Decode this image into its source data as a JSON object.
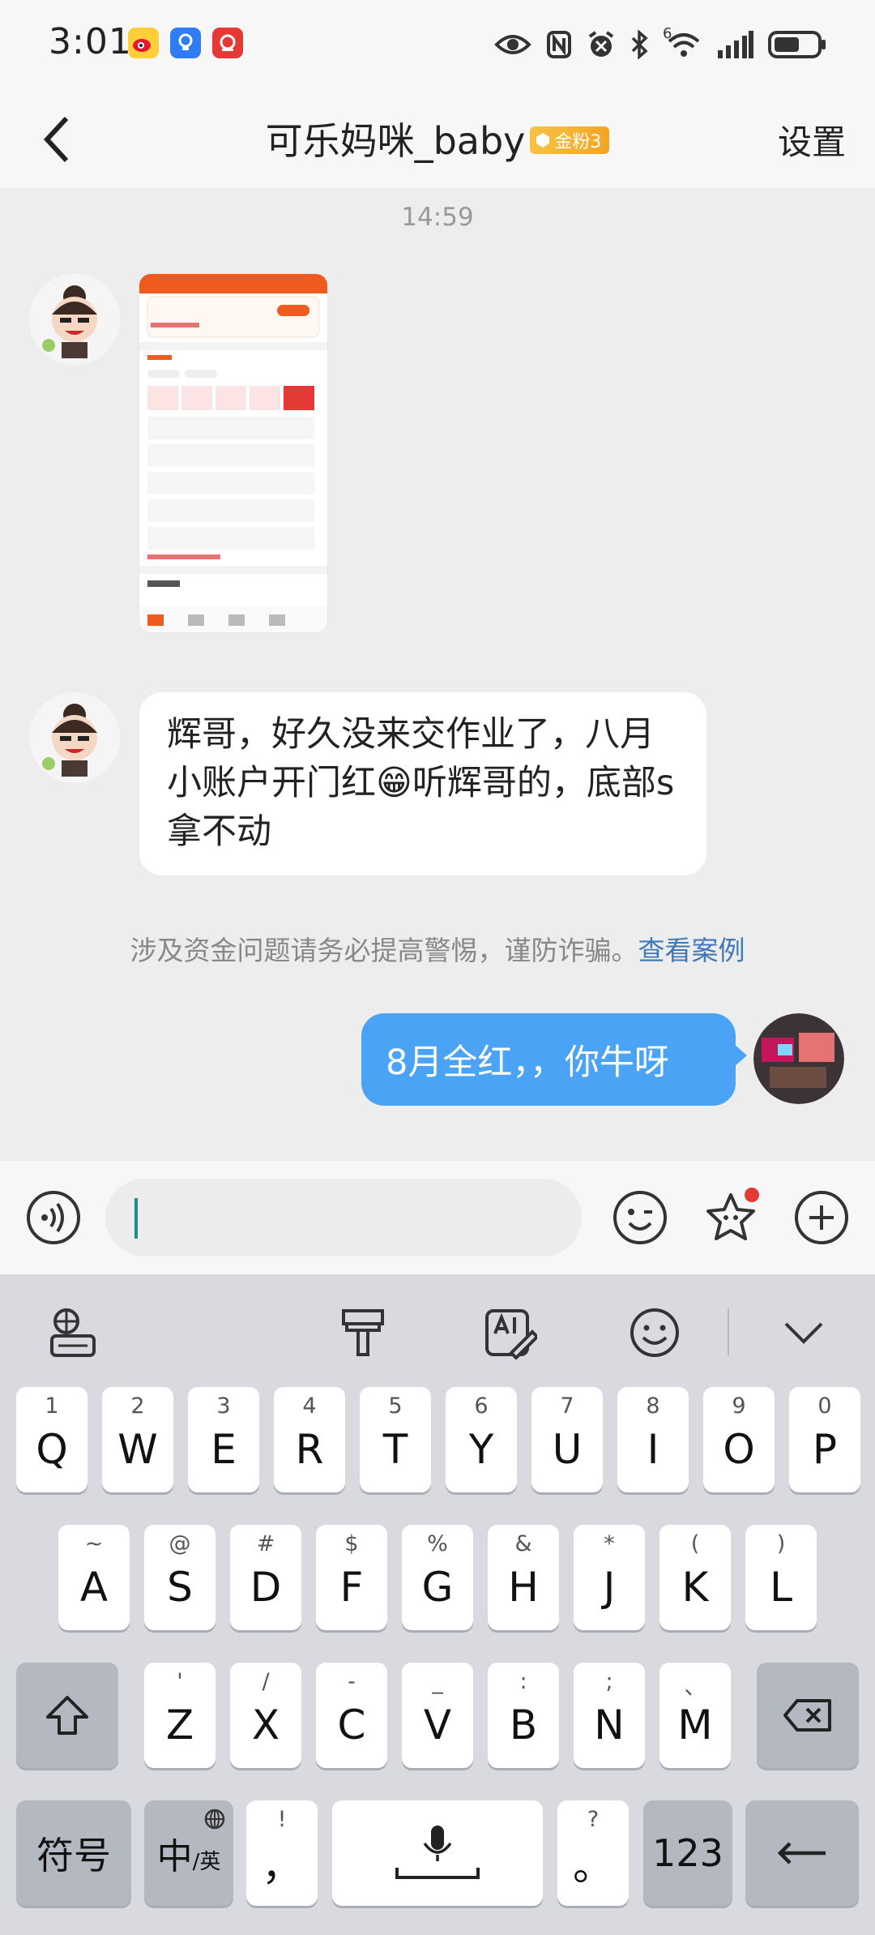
{
  "status_bar": {
    "time": "3:01",
    "apps": [
      "weibo-icon",
      "bulb-app-icon",
      "camera-app-icon"
    ],
    "indicators": [
      "eye-icon",
      "nfc-icon",
      "alarm-icon",
      "bluetooth-icon",
      "wifi-icon",
      "signal-icon",
      "battery-icon"
    ],
    "wifi_label": "6"
  },
  "header": {
    "title": "可乐妈咪_baby",
    "fan_badge": "金粉3",
    "settings_label": "设置"
  },
  "chat": {
    "timestamp": "14:59",
    "messages": [
      {
        "type": "image",
        "side": "left"
      },
      {
        "type": "text",
        "side": "left",
        "text": "辉哥，好久没来交作业了，八月小账户开门红😁听辉哥的，底部s拿不动"
      },
      {
        "type": "notice",
        "text": "涉及资金问题请务必提高警惕，谨防诈骗。",
        "link": "查看案例"
      },
      {
        "type": "text",
        "side": "right",
        "text": "8月全红，，你牛呀"
      }
    ]
  },
  "input_bar": {
    "value": "",
    "placeholder": ""
  },
  "keyboard": {
    "rows": [
      [
        {
          "main": "Q",
          "sub": "1"
        },
        {
          "main": "W",
          "sub": "2"
        },
        {
          "main": "E",
          "sub": "3"
        },
        {
          "main": "R",
          "sub": "4"
        },
        {
          "main": "T",
          "sub": "5"
        },
        {
          "main": "Y",
          "sub": "6"
        },
        {
          "main": "U",
          "sub": "7"
        },
        {
          "main": "I",
          "sub": "8"
        },
        {
          "main": "O",
          "sub": "9"
        },
        {
          "main": "P",
          "sub": "0"
        }
      ],
      [
        {
          "main": "A",
          "sub": "~"
        },
        {
          "main": "S",
          "sub": "@"
        },
        {
          "main": "D",
          "sub": "#"
        },
        {
          "main": "F",
          "sub": "$"
        },
        {
          "main": "G",
          "sub": "%"
        },
        {
          "main": "H",
          "sub": "&"
        },
        {
          "main": "J",
          "sub": "*"
        },
        {
          "main": "K",
          "sub": "("
        },
        {
          "main": "L",
          "sub": ")"
        }
      ],
      [
        {
          "main": "Z",
          "sub": "'"
        },
        {
          "main": "X",
          "sub": "/"
        },
        {
          "main": "C",
          "sub": "-"
        },
        {
          "main": "V",
          "sub": "_"
        },
        {
          "main": "B",
          "sub": ":"
        },
        {
          "main": "N",
          "sub": ";"
        },
        {
          "main": "M",
          "sub": "、"
        }
      ]
    ],
    "symbols_label": "符号",
    "lang_label": "中",
    "lang_sub": "/英",
    "comma_label": "，",
    "comma_sub": "!",
    "period_label": "。",
    "period_sub": "?",
    "num_label": "123"
  }
}
